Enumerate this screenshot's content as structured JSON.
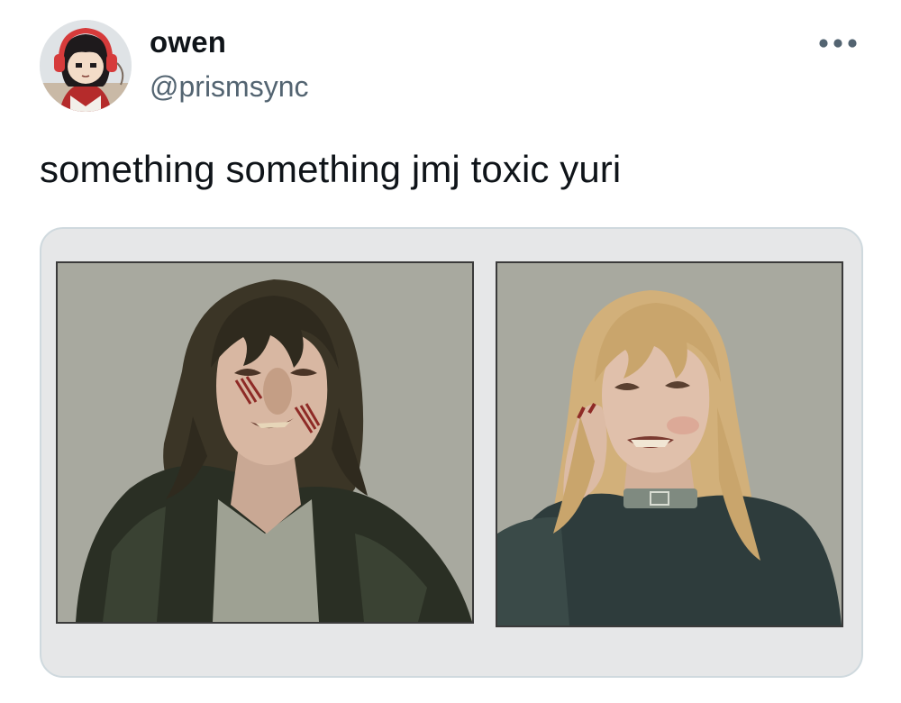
{
  "tweet": {
    "author": {
      "display_name": "owen",
      "handle": "@prismsync"
    },
    "text": "something something jmj toxic yuri",
    "more_icon": "more-horizontal-icon"
  },
  "media": {
    "panels": [
      "dark-haired-character-illustration",
      "blonde-character-illustration"
    ]
  },
  "colors": {
    "text_primary": "#0f1419",
    "text_secondary": "#536471",
    "card_border": "#cfd9de",
    "panel_bg": "#a8a99f"
  }
}
